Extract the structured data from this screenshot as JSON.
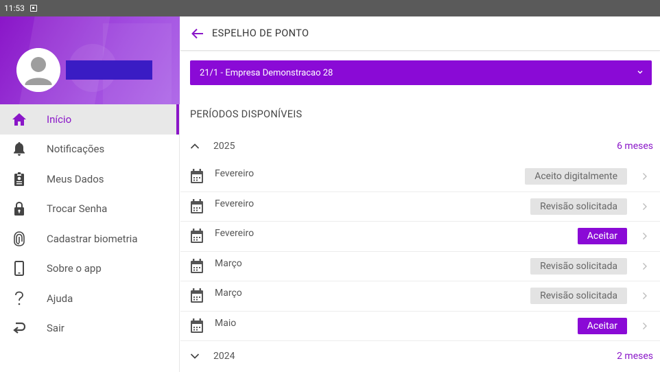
{
  "status_bar": {
    "time": "11:53"
  },
  "sidebar": {
    "items": [
      {
        "label": "Início",
        "icon": "home-icon",
        "active": true
      },
      {
        "label": "Notificações",
        "icon": "bell-icon",
        "active": false
      },
      {
        "label": "Meus Dados",
        "icon": "id-badge-icon",
        "active": false
      },
      {
        "label": "Trocar Senha",
        "icon": "lock-icon",
        "active": false
      },
      {
        "label": "Cadastrar biometria",
        "icon": "fingerprint-icon",
        "active": false
      },
      {
        "label": "Sobre o app",
        "icon": "phone-icon",
        "active": false
      },
      {
        "label": "Ajuda",
        "icon": "question-icon",
        "active": false
      },
      {
        "label": "Sair",
        "icon": "logout-icon",
        "active": false
      }
    ]
  },
  "header": {
    "title": "ESPELHO DE PONTO"
  },
  "company": {
    "selected": "21/1 - Empresa Demonstracao 28"
  },
  "section_title": "PERÍODOS DISPONÍVEIS",
  "years": [
    {
      "year": "2025",
      "count": "6 meses",
      "expanded": true
    },
    {
      "year": "2024",
      "count": "2 meses",
      "expanded": false
    }
  ],
  "periods": [
    {
      "month": "Fevereiro",
      "status": "Aceito digitalmente",
      "style": "grey"
    },
    {
      "month": "Fevereiro",
      "status": "Revisão solicitada",
      "style": "grey"
    },
    {
      "month": "Fevereiro",
      "status": "Aceitar",
      "style": "purple"
    },
    {
      "month": "Março",
      "status": "Revisão solicitada",
      "style": "grey"
    },
    {
      "month": "Março",
      "status": "Revisão solicitada",
      "style": "grey"
    },
    {
      "month": "Maio",
      "status": "Aceitar",
      "style": "purple"
    }
  ],
  "colors": {
    "accent": "#8a16c8",
    "company_bar": "#8a0ad6",
    "status_bar": "#5a5a5a"
  }
}
